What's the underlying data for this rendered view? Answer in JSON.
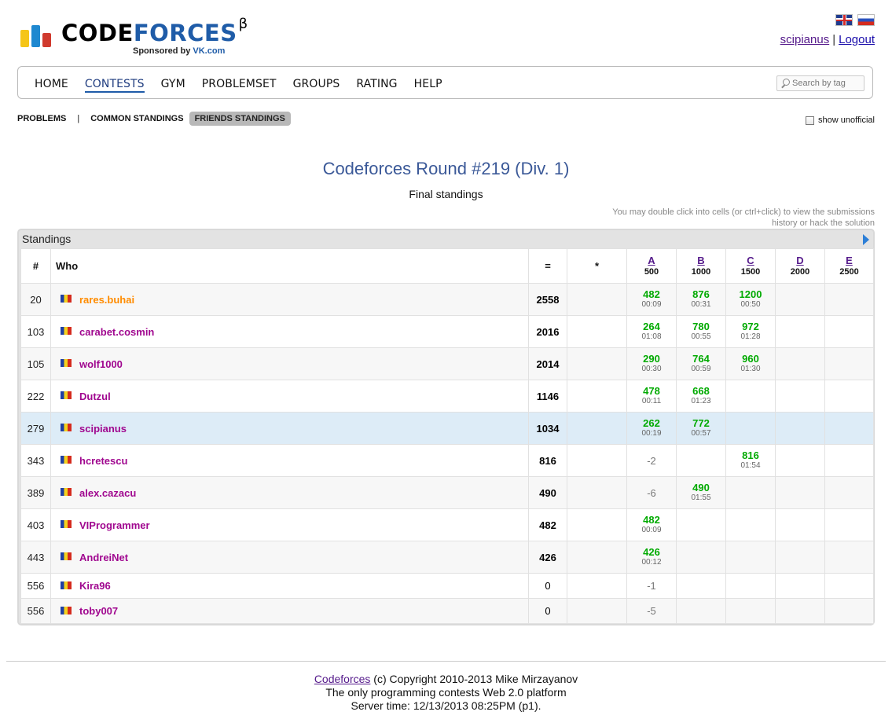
{
  "header": {
    "logo_prefix": "CODE",
    "logo_highlight": "FORCES",
    "beta": "β",
    "sponsor_prefix": "Sponsored by ",
    "sponsor_name": "VK.com",
    "username": "scipianus",
    "separator": "|",
    "logout": "Logout"
  },
  "menu": [
    "HOME",
    "CONTESTS",
    "GYM",
    "PROBLEMSET",
    "GROUPS",
    "RATING",
    "HELP"
  ],
  "search": {
    "placeholder": "Search by tag"
  },
  "submenu": {
    "problems": "PROBLEMS",
    "divider": "|",
    "common": "COMMON STANDINGS",
    "friends": "FRIENDS STANDINGS",
    "show_unofficial": "show unofficial"
  },
  "contest_title": "Codeforces Round #219 (Div. 1)",
  "final_standings": "Final standings",
  "hint": "You may double click into cells (or ctrl+click) to view the submissions history or hack the solution",
  "standings_caption": "Standings",
  "table": {
    "headers": {
      "rank": "#",
      "who": "Who",
      "score": "=",
      "hacks": "*"
    },
    "problems": [
      {
        "letter": "A",
        "points": "500"
      },
      {
        "letter": "B",
        "points": "1000"
      },
      {
        "letter": "C",
        "points": "1500"
      },
      {
        "letter": "D",
        "points": "2000"
      },
      {
        "letter": "E",
        "points": "2500"
      }
    ],
    "rows": [
      {
        "rank": "20",
        "handle": "rares.buhai",
        "score": "2558",
        "cells": [
          {
            "v": "482",
            "t": "00:09"
          },
          {
            "v": "876",
            "t": "00:31"
          },
          {
            "v": "1200",
            "t": "00:50"
          },
          null,
          null
        ]
      },
      {
        "rank": "103",
        "handle": "carabet.cosmin",
        "score": "2016",
        "cells": [
          {
            "v": "264",
            "t": "01:08"
          },
          {
            "v": "780",
            "t": "00:55"
          },
          {
            "v": "972",
            "t": "01:28"
          },
          null,
          null
        ]
      },
      {
        "rank": "105",
        "handle": "wolf1000",
        "score": "2014",
        "cells": [
          {
            "v": "290",
            "t": "00:30"
          },
          {
            "v": "764",
            "t": "00:59"
          },
          {
            "v": "960",
            "t": "01:30"
          },
          null,
          null
        ]
      },
      {
        "rank": "222",
        "handle": "Dutzul",
        "score": "1146",
        "cells": [
          {
            "v": "478",
            "t": "00:11"
          },
          {
            "v": "668",
            "t": "01:23"
          },
          null,
          null,
          null
        ]
      },
      {
        "rank": "279",
        "handle": "scipianus",
        "score": "1034",
        "cells": [
          {
            "v": "262",
            "t": "00:19"
          },
          {
            "v": "772",
            "t": "00:57"
          },
          null,
          null,
          null
        ]
      },
      {
        "rank": "343",
        "handle": "hcretescu",
        "score": "816",
        "cells": [
          {
            "n": "-2"
          },
          null,
          {
            "v": "816",
            "t": "01:54"
          },
          null,
          null
        ]
      },
      {
        "rank": "389",
        "handle": "alex.cazacu",
        "score": "490",
        "cells": [
          {
            "n": "-6"
          },
          {
            "v": "490",
            "t": "01:55"
          },
          null,
          null,
          null
        ]
      },
      {
        "rank": "403",
        "handle": "VIProgrammer",
        "score": "482",
        "cells": [
          {
            "v": "482",
            "t": "00:09"
          },
          null,
          null,
          null,
          null
        ]
      },
      {
        "rank": "443",
        "handle": "AndreiNet",
        "score": "426",
        "cells": [
          {
            "v": "426",
            "t": "00:12"
          },
          null,
          null,
          null,
          null
        ]
      },
      {
        "rank": "556",
        "handle": "Kira96",
        "score": "0",
        "cells": [
          {
            "n": "-1"
          },
          null,
          null,
          null,
          null
        ]
      },
      {
        "rank": "556",
        "handle": "toby007",
        "score": "0",
        "cells": [
          {
            "n": "-5"
          },
          null,
          null,
          null,
          null
        ]
      }
    ]
  },
  "footer": {
    "link": "Codeforces",
    "line1_rest": " (c) Copyright 2010-2013 Mike Mirzayanov",
    "line2": "The only programming contests Web 2.0 platform",
    "line3": "Server time: 12/13/2013 08:25PM (p1)."
  },
  "colors": {
    "accent": "#3b5998",
    "accepted": "#00aa00",
    "handle_purple": "#a0078f",
    "handle_orange": "#ff8c00",
    "highlight_row": "#ddecf7"
  }
}
